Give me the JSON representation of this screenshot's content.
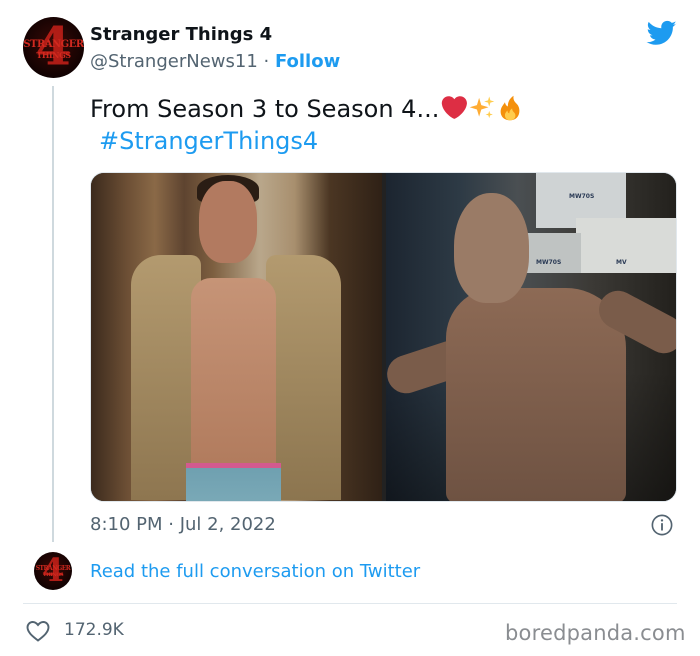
{
  "author": {
    "name": "Stranger Things 4",
    "handle": "@StrangerNews11",
    "separator": " · ",
    "follow_label": "Follow",
    "avatar_logo_line1": "STRANGER",
    "avatar_logo_line2": "THINGS",
    "avatar_logo_numeral": "4"
  },
  "tweet": {
    "text": "From Season 3 to Season 4...",
    "emojis": [
      "red-heart-emoji",
      "sparkles-emoji",
      "fire-emoji"
    ],
    "hashtag": "#StrangerThings4",
    "media_box_labels": [
      "MW70S",
      "MW70S",
      "MV"
    ]
  },
  "meta": {
    "timestamp": "8:10 PM · Jul 2, 2022"
  },
  "conversation": {
    "link_label": "Read the full conversation on Twitter"
  },
  "actions": {
    "like_count": "172.9K"
  },
  "watermark": {
    "text": "boredpanda.com"
  },
  "colors": {
    "accent": "#1d9bf0",
    "secondary_text": "#536471",
    "primary_text": "#0f1419",
    "divider": "#e1e8ed"
  },
  "icons": {
    "brand": "twitter-bird-icon",
    "info": "info-icon",
    "like": "heart-icon"
  }
}
